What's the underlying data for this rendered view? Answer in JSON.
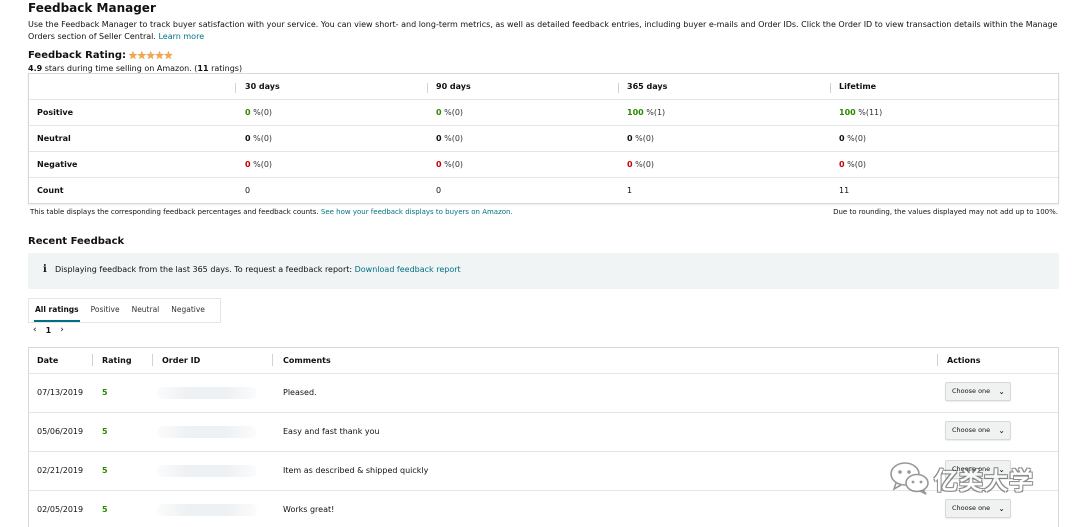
{
  "page": {
    "title": "Feedback Manager",
    "intro": "Use the Feedback Manager to track buyer satisfaction with your service. You can view short- and long-term metrics, as well as detailed feedback entries, including buyer e-mails and Order IDs. Click the Order ID to view transaction details within the Manage Orders section of Seller Central.",
    "learn_more": "Learn more"
  },
  "rating": {
    "label": "Feedback Rating:",
    "stars": 5,
    "score": "4.9",
    "sub_mid": " stars during time selling on Amazon. (",
    "count": "11",
    "sub_end": " ratings)"
  },
  "summary": {
    "columns": [
      "30 days",
      "90 days",
      "365 days",
      "Lifetime"
    ],
    "rows": [
      {
        "label": "Positive",
        "cells": [
          {
            "num": "0",
            "pct": " %(0)",
            "tone": "pos"
          },
          {
            "num": "0",
            "pct": " %(0)",
            "tone": "pos"
          },
          {
            "num": "100",
            "pct": " %(1)",
            "tone": "pos"
          },
          {
            "num": "100",
            "pct": " %(11)",
            "tone": "pos"
          }
        ]
      },
      {
        "label": "Neutral",
        "cells": [
          {
            "num": "0",
            "pct": " %(0)",
            "tone": "zero"
          },
          {
            "num": "0",
            "pct": " %(0)",
            "tone": "zero"
          },
          {
            "num": "0",
            "pct": " %(0)",
            "tone": "zero"
          },
          {
            "num": "0",
            "pct": " %(0)",
            "tone": "zero"
          }
        ]
      },
      {
        "label": "Negative",
        "cells": [
          {
            "num": "0",
            "pct": " %(0)",
            "tone": "neg"
          },
          {
            "num": "0",
            "pct": " %(0)",
            "tone": "neg"
          },
          {
            "num": "0",
            "pct": " %(0)",
            "tone": "neg"
          },
          {
            "num": "0",
            "pct": " %(0)",
            "tone": "neg"
          }
        ]
      },
      {
        "label": "Count",
        "cells": [
          {
            "num": "0",
            "pct": "",
            "tone": "plain"
          },
          {
            "num": "0",
            "pct": "",
            "tone": "plain"
          },
          {
            "num": "1",
            "pct": "",
            "tone": "plain"
          },
          {
            "num": "11",
            "pct": "",
            "tone": "plain"
          }
        ]
      }
    ],
    "note": "This table displays the corresponding feedback percentages and feedback counts.",
    "note_link": "See how your feedback displays to buyers on Amazon.",
    "rounding_note": "Due to rounding, the values displayed may not add up to 100%."
  },
  "recent": {
    "title": "Recent Feedback",
    "info_icon": "i",
    "info_text": "Displaying feedback from the last 365 days. To request a feedback report:",
    "info_link": "Download feedback report",
    "tabs": [
      "All ratings",
      "Positive",
      "Neutral",
      "Negative"
    ],
    "active_tab": "All ratings",
    "pager": {
      "prev": "‹",
      "page": "1",
      "next": "›"
    },
    "headers": {
      "date": "Date",
      "rating": "Rating",
      "order_id": "Order ID",
      "comments": "Comments",
      "actions": "Actions"
    },
    "rows": [
      {
        "date": "07/13/2019",
        "rating": "5",
        "comment": "Pleased.",
        "action": "Choose one"
      },
      {
        "date": "05/06/2019",
        "rating": "5",
        "comment": "Easy and fast thank you",
        "action": "Choose one"
      },
      {
        "date": "02/21/2019",
        "rating": "5",
        "comment": "Item as described & shipped quickly",
        "action": "Choose one"
      },
      {
        "date": "02/05/2019",
        "rating": "5",
        "comment": "Works great!",
        "action": "Choose one"
      }
    ]
  },
  "watermark": {
    "text": "亿类大学",
    "icon": "wechat-icon"
  },
  "colors": {
    "positive": "#2b8a00",
    "negative": "#c40000",
    "link": "#007185",
    "star": "#f3a847",
    "info_bg": "#f0f4f4"
  }
}
